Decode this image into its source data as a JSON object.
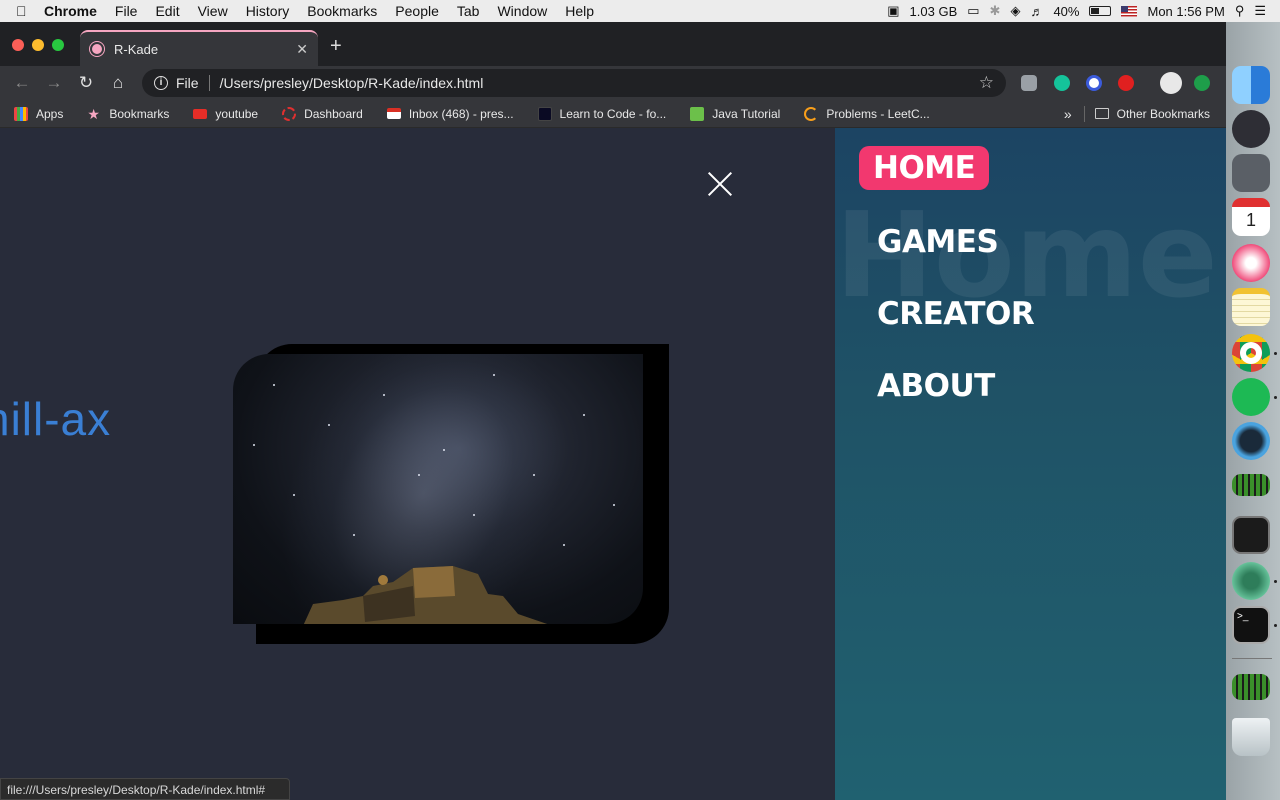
{
  "menubar": {
    "app_name": "Chrome",
    "items": [
      "File",
      "Edit",
      "View",
      "History",
      "Bookmarks",
      "People",
      "Tab",
      "Window",
      "Help"
    ],
    "memory": "1.03 GB",
    "battery": "40%",
    "clock": "Mon 1:56 PM"
  },
  "browser": {
    "tab_title": "R-Kade",
    "url_scheme": "File",
    "url": "/Users/presley/Desktop/R-Kade/index.html",
    "bookmarks": [
      "Apps",
      "Bookmarks",
      "youtube",
      "Dashboard",
      "Inbox (468) - pres...",
      "Learn to Code - fo...",
      "Java Tutorial",
      "Problems - LeetC..."
    ],
    "overflow": "»",
    "other_bookmarks": "Other Bookmarks",
    "status_url": "file:///Users/presley/Desktop/R-Kade/index.html#"
  },
  "page": {
    "brand_text": "hill-ax",
    "menu_bg_text": "Home",
    "menu": [
      "HOME",
      "GAMES",
      "CREATOR",
      "ABOUT"
    ],
    "active_menu": "HOME"
  },
  "colors": {
    "accent": "#f2386f",
    "brand": "#3a7fd4",
    "page_bg": "#282c3a",
    "menu_top": "#1c4463",
    "menu_bottom": "#206170"
  },
  "dock": [
    "finder-icon",
    "launchpad-icon",
    "system-preferences-icon",
    "calendar-icon",
    "itunes-icon",
    "notes-icon",
    "chrome-icon",
    "spotify-icon",
    "quicktime-icon",
    "memory-icon",
    "activity-monitor-icon",
    "atom-icon",
    "terminal-icon",
    "memory-clean-icon",
    "trash-icon"
  ],
  "calendar_month": "JUN",
  "calendar_day": "1"
}
